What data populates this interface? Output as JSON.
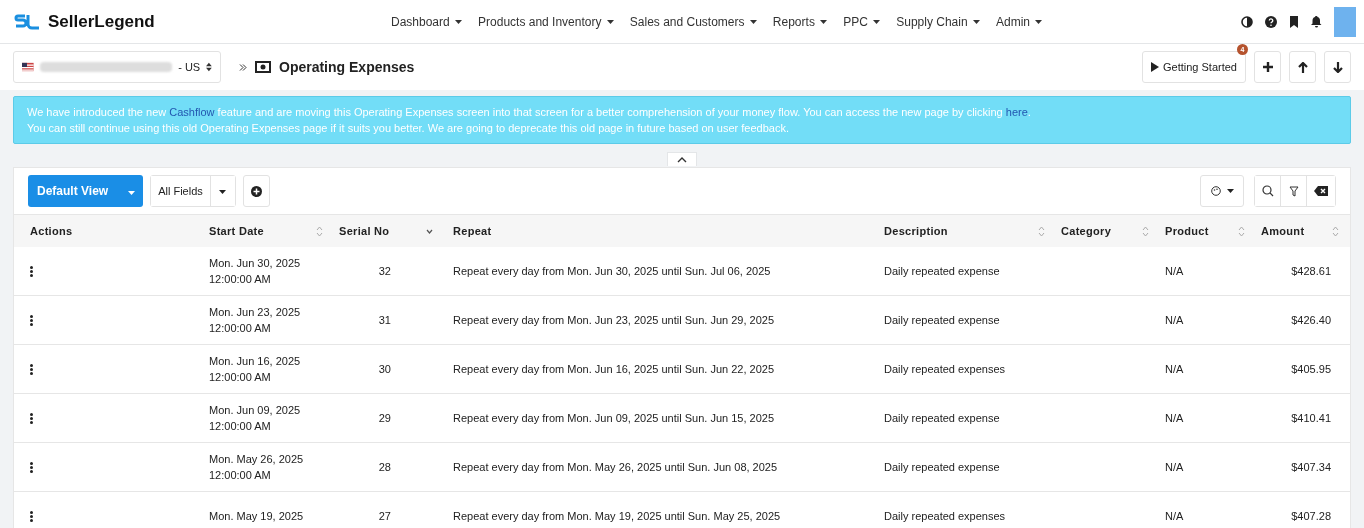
{
  "brand": "SellerLegend",
  "nav": [
    {
      "label": "Dashboard"
    },
    {
      "label": "Products and Inventory"
    },
    {
      "label": "Sales and Customers"
    },
    {
      "label": "Reports"
    },
    {
      "label": "PPC"
    },
    {
      "label": "Supply Chain"
    },
    {
      "label": "Admin"
    }
  ],
  "store_selector": {
    "marketplace": "- US"
  },
  "page_title": "Operating Expenses",
  "getting_started": {
    "label": "Getting Started",
    "badge": "4"
  },
  "banner": {
    "line1_before": "We have introduced the new ",
    "link1": "Cashflow",
    "line1_middle": " feature and are moving this Operating Expenses screen into that screen for a better comprehension of your money flow. You can access the new page by clicking ",
    "link2": "here",
    "line1_after": ".",
    "line2": "You can still continue using this old Operating Expenses page if it suits you better. We are going to deprecate this old page in future based on user feedback."
  },
  "toolbar": {
    "view": "Default View",
    "fields": "All Fields"
  },
  "table": {
    "columns": [
      {
        "label": "Actions",
        "sortable": false
      },
      {
        "label": "Start Date",
        "sortable": true,
        "sorted": false
      },
      {
        "label": "Serial No",
        "sortable": true,
        "sorted": true
      },
      {
        "label": "Repeat",
        "sortable": false
      },
      {
        "label": "Description",
        "sortable": true,
        "sorted": false
      },
      {
        "label": "Category",
        "sortable": true,
        "sorted": false
      },
      {
        "label": "Product",
        "sortable": true,
        "sorted": false
      },
      {
        "label": "Amount",
        "sortable": true,
        "sorted": false
      }
    ],
    "rows": [
      {
        "date": "Mon. Jun 30, 2025",
        "time": "12:00:00 AM",
        "serial": "32",
        "repeat": "Repeat every day from Mon. Jun 30, 2025 until Sun. Jul 06, 2025",
        "description": "Daily repeated expense",
        "product": "N/A",
        "amount": "$428.61"
      },
      {
        "date": "Mon. Jun 23, 2025",
        "time": "12:00:00 AM",
        "serial": "31",
        "repeat": "Repeat every day from Mon. Jun 23, 2025 until Sun. Jun 29, 2025",
        "description": "Daily repeated expense",
        "product": "N/A",
        "amount": "$426.40"
      },
      {
        "date": "Mon. Jun 16, 2025",
        "time": "12:00:00 AM",
        "serial": "30",
        "repeat": "Repeat every day from Mon. Jun 16, 2025 until Sun. Jun 22, 2025",
        "description": "Daily repeated expenses",
        "product": "N/A",
        "amount": "$405.95"
      },
      {
        "date": "Mon. Jun 09, 2025",
        "time": "12:00:00 AM",
        "serial": "29",
        "repeat": "Repeat every day from Mon. Jun 09, 2025 until Sun. Jun 15, 2025",
        "description": "Daily repeated expense",
        "product": "N/A",
        "amount": "$410.41"
      },
      {
        "date": "Mon. May 26, 2025",
        "time": "12:00:00 AM",
        "serial": "28",
        "repeat": "Repeat every day from Mon. May 26, 2025 until Sun. Jun 08, 2025",
        "description": "Daily repeated expense",
        "product": "N/A",
        "amount": "$407.34"
      },
      {
        "date": "Mon. May 19, 2025",
        "serial": "27",
        "repeat": "Repeat every day from Mon. May 19, 2025 until Sun. May 25, 2025",
        "description": "Daily repeated expenses",
        "product": "N/A",
        "amount": "$407.28"
      }
    ]
  }
}
